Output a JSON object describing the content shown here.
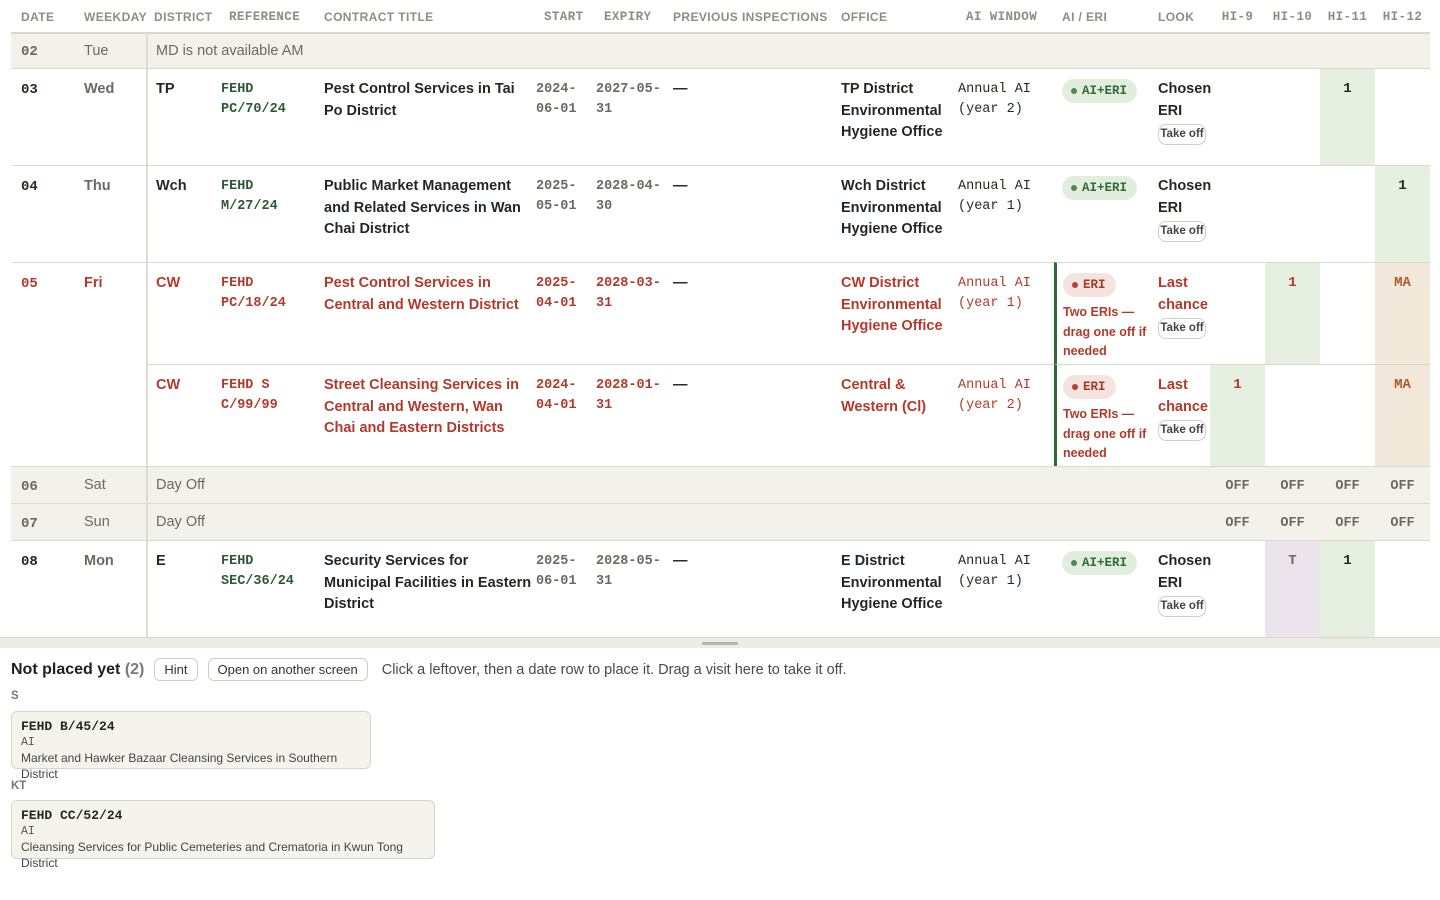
{
  "headers": {
    "date": "DATE",
    "weekday": "WEEKDAY",
    "district": "DISTRICT",
    "reference": "REFERENCE",
    "contract_title": "CONTRACT TITLE",
    "start": "START",
    "expiry": "EXPIRY",
    "previous_inspections": "PREVIOUS INSPECTIONS",
    "office": "OFFICE",
    "ai_window": "AI WINDOW",
    "ai_eri": "AI / ERI",
    "look": "LOOK",
    "hi9": "HI-9",
    "hi10": "HI-10",
    "hi11": "HI-11",
    "hi12": "HI-12"
  },
  "rows": {
    "r02": {
      "date": "02",
      "weekday": "Tue",
      "note": "MD is not available AM"
    },
    "r03": {
      "date": "03",
      "weekday": "Wed",
      "district": "TP",
      "reference": "FEHD PC/70/24",
      "title": "Pest Control Services in Tai Po District",
      "start": "2024-06-01",
      "expiry": "2027-05-31",
      "prev": "—",
      "office": "TP District Environmental Hygiene Office",
      "ai_window": "Annual AI (year 2)",
      "badge": "AI+ERI",
      "look": "Chosen ERI",
      "take_off": "Take off",
      "hi11": "1"
    },
    "r04": {
      "date": "04",
      "weekday": "Thu",
      "district": "Wch",
      "reference": "FEHD M/27/24",
      "title": "Public Market Management and Related Services in Wan Chai District",
      "start": "2025-05-01",
      "expiry": "2028-04-30",
      "prev": "—",
      "office": "Wch District Environmental Hygiene Office",
      "ai_window": "Annual AI (year 1)",
      "badge": "AI+ERI",
      "look": "Chosen ERI",
      "take_off": "Take off",
      "hi12": "1"
    },
    "r05a": {
      "date": "05",
      "weekday": "Fri",
      "district": "CW",
      "reference": "FEHD PC/18/24",
      "title": "Pest Control Services in Central and Western District",
      "start": "2025-04-01",
      "expiry": "2028-03-31",
      "prev": "—",
      "office": "CW District Environmental Hygiene Office",
      "ai_window": "Annual AI (year 1)",
      "badge": "ERI",
      "warn": "Two ERIs — drag one off if needed",
      "look": "Last chance",
      "take_off": "Take off",
      "hi10": "1",
      "hi12": "MA"
    },
    "r05b": {
      "district": "CW",
      "reference": "FEHD S C/99/99",
      "title": "Street Cleansing Services in Central and Western, Wan Chai and Eastern Districts",
      "start": "2024-04-01",
      "expiry": "2028-01-31",
      "prev": "—",
      "office": "Central & Western (Cl)",
      "ai_window": "Annual AI (year 2)",
      "badge": "ERI",
      "warn": "Two ERIs — drag one off if needed",
      "look": "Last chance",
      "take_off": "Take off",
      "hi9": "1",
      "hi12": "MA"
    },
    "r06": {
      "date": "06",
      "weekday": "Sat",
      "note": "Day Off",
      "off": "OFF"
    },
    "r07": {
      "date": "07",
      "weekday": "Sun",
      "note": "Day Off",
      "off": "OFF"
    },
    "r08": {
      "date": "08",
      "weekday": "Mon",
      "district": "E",
      "reference": "FEHD SEC/36/24",
      "title": "Security Services for Municipal Facilities in Eastern District",
      "start": "2025-06-01",
      "expiry": "2028-05-31",
      "prev": "—",
      "office": "E District Environmental Hygiene Office",
      "ai_window": "Annual AI (year 1)",
      "badge": "AI+ERI",
      "look": "Chosen ERI",
      "take_off": "Take off",
      "hi10": "T",
      "hi11": "1"
    }
  },
  "panel": {
    "title": "Not placed yet",
    "count": "(2)",
    "hint_button": "Hint",
    "open_button": "Open on another screen",
    "message": "Click a leftover, then a date row to place it. Drag a visit here to take it off.",
    "groups": [
      {
        "label": "S",
        "reference": "FEHD B/45/24",
        "kind": "AI",
        "title": "Market and Hawker Bazaar Cleansing Services in Southern District"
      },
      {
        "label": "KT",
        "reference": "FEHD CC/52/24",
        "kind": "AI",
        "title": "Cleansing Services for Public Cemeteries and Crematoria in Kwun Tong District"
      }
    ]
  },
  "colors": {
    "accent_green": "#2d5a35",
    "warning_red": "#b33a2a",
    "hi_green": "#e6f0e1",
    "hi_purple": "#ece4ec",
    "hi_tan": "#f2e8da"
  }
}
